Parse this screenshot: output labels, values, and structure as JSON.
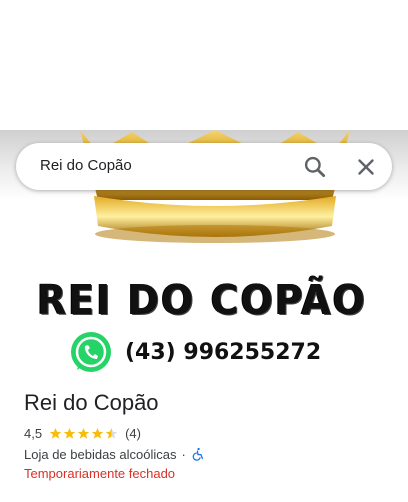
{
  "search": {
    "query": "Rei do Copão"
  },
  "hero": {
    "logo_text": "REI DO COPÃO",
    "phone": "(43) 996255272"
  },
  "place": {
    "name": "Rei do Copão",
    "rating": "4,5",
    "rating_value": 4.5,
    "review_count": "(4)",
    "category": "Loja de bebidas alcoólicas",
    "separator": "·",
    "status": "Temporariamente fechado"
  },
  "colors": {
    "star": "#fbbc04",
    "status_closed": "#d93025",
    "accessibility": "#1a73e8",
    "whatsapp": "#25d366"
  },
  "icons": {
    "search": "search-icon",
    "close": "close-icon",
    "whatsapp": "whatsapp-icon",
    "accessibility": "wheelchair-icon"
  }
}
